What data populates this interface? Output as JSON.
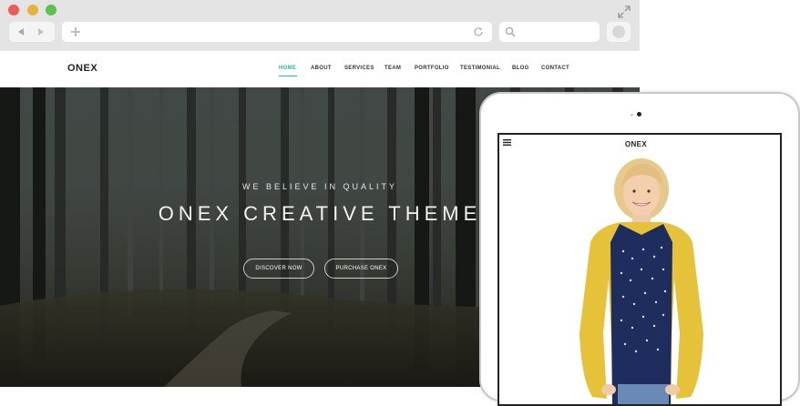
{
  "browser": {
    "window_controls": [
      "close",
      "minimize",
      "zoom"
    ],
    "icons": [
      "back-arrow-icon",
      "forward-arrow-icon",
      "plus-icon",
      "reload-icon",
      "search-icon",
      "expand-icon"
    ]
  },
  "site": {
    "logo": "ONEX",
    "nav": [
      {
        "label": "HOME",
        "active": true
      },
      {
        "label": "ABOUT",
        "active": false
      },
      {
        "label": "SERVICES",
        "active": false
      },
      {
        "label": "TEAM",
        "active": false
      },
      {
        "label": "PORTFOLIO",
        "active": false
      },
      {
        "label": "TESTIMONIAL",
        "active": false
      },
      {
        "label": "BLOG",
        "active": false
      },
      {
        "label": "CONTACT",
        "active": false
      }
    ],
    "accent_color": "#2bb9a8"
  },
  "hero": {
    "tagline": "WE BELIEVE IN QUALITY",
    "heading": "ONEX CREATIVE THEME",
    "buttons": [
      {
        "label": "DISCOVER NOW"
      },
      {
        "label": "PURCHASE ONEX"
      }
    ]
  },
  "tablet": {
    "logo": "ONEX",
    "icons": [
      "hamburger-menu-icon"
    ]
  }
}
